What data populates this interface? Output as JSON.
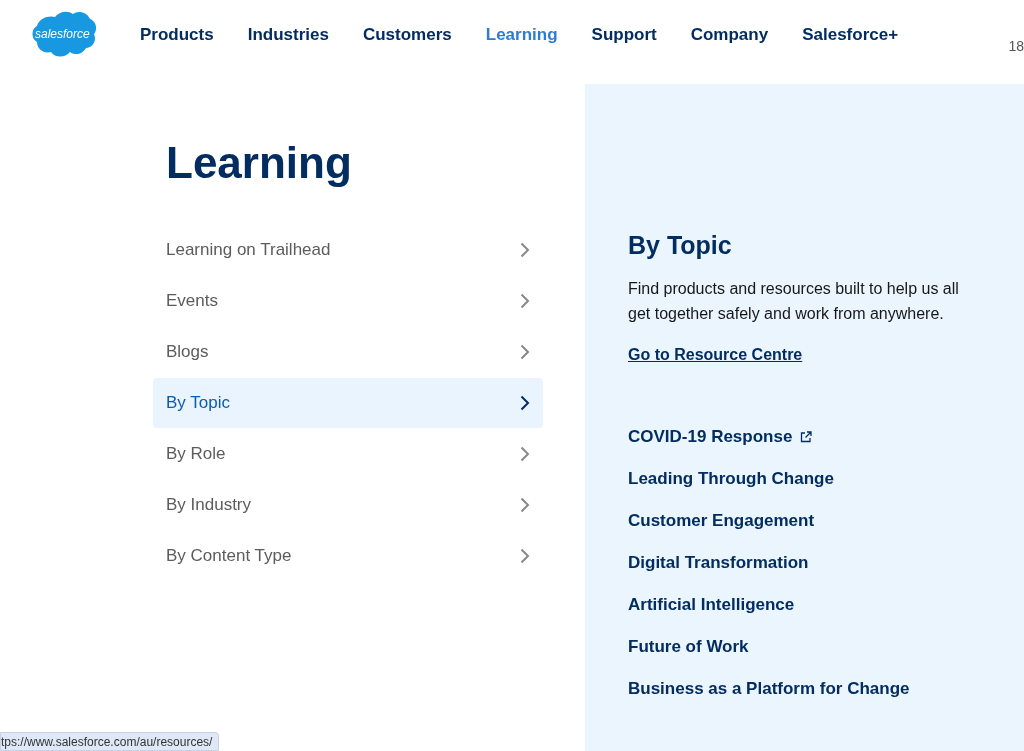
{
  "header": {
    "logo": "salesforce",
    "nav": [
      {
        "label": "Products",
        "selected": false
      },
      {
        "label": "Industries",
        "selected": false
      },
      {
        "label": "Customers",
        "selected": false
      },
      {
        "label": "Learning",
        "selected": true
      },
      {
        "label": "Support",
        "selected": false
      },
      {
        "label": "Company",
        "selected": false
      },
      {
        "label": "Salesforce+",
        "selected": false
      }
    ],
    "corner_text": "18"
  },
  "menu": {
    "title": "Learning",
    "items": [
      {
        "label": "Learning on Trailhead",
        "selected": false
      },
      {
        "label": "Events",
        "selected": false
      },
      {
        "label": "Blogs",
        "selected": false
      },
      {
        "label": "By Topic",
        "selected": true
      },
      {
        "label": "By Role",
        "selected": false
      },
      {
        "label": "By Industry",
        "selected": false
      },
      {
        "label": "By Content Type",
        "selected": false
      }
    ]
  },
  "panel": {
    "title": "By Topic",
    "description": "Find products and resources built to help us all get together safely and work from anywhere.",
    "cta": "Go to Resource Centre",
    "links": [
      {
        "label": "COVID-19 Response",
        "external": true
      },
      {
        "label": "Leading Through Change",
        "external": false
      },
      {
        "label": "Customer Engagement",
        "external": false
      },
      {
        "label": "Digital Transformation",
        "external": false
      },
      {
        "label": "Artificial Intelligence",
        "external": false
      },
      {
        "label": "Future of Work",
        "external": false
      },
      {
        "label": "Business as a Platform for Change",
        "external": false
      }
    ]
  },
  "status_bar": {
    "url": "tps://www.salesforce.com/au/resources/"
  }
}
